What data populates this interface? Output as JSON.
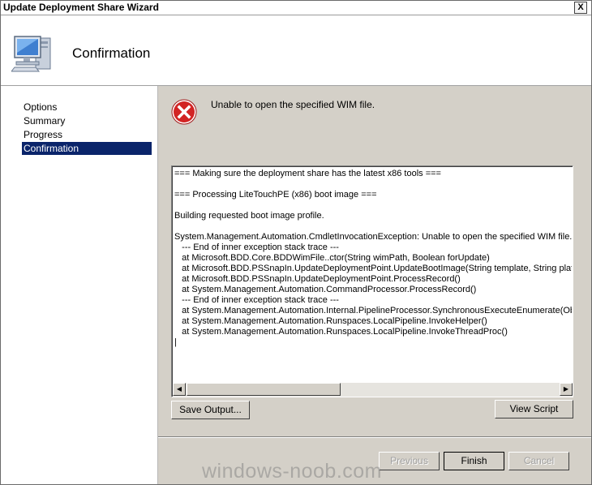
{
  "window": {
    "title": "Update Deployment Share Wizard",
    "close_label": "X"
  },
  "header": {
    "icon": "computer-monitor-icon",
    "title": "Confirmation"
  },
  "sidebar": {
    "items": [
      {
        "label": "Options",
        "active": false
      },
      {
        "label": "Summary",
        "active": false
      },
      {
        "label": "Progress",
        "active": false
      },
      {
        "label": "Confirmation",
        "active": true
      }
    ]
  },
  "content": {
    "error_icon": "error-x-icon",
    "error_message": "Unable to open the specified WIM file.",
    "log_lines": [
      "=== Making sure the deployment share has the latest x86 tools ===",
      "",
      "=== Processing LiteTouchPE (x86) boot image ===",
      "",
      "Building requested boot image profile.",
      "",
      "System.Management.Automation.CmdletInvocationException: Unable to open the specified WIM file. --->",
      "   --- End of inner exception stack trace ---",
      "   at Microsoft.BDD.Core.BDDWimFile..ctor(String wimPath, Boolean forUpdate)",
      "   at Microsoft.BDD.PSSnapIn.UpdateDeploymentPoint.UpdateBootImage(String template, String platform",
      "   at Microsoft.BDD.PSSnapIn.UpdateDeploymentPoint.ProcessRecord()",
      "   at System.Management.Automation.CommandProcessor.ProcessRecord()",
      "   --- End of inner exception stack trace ---",
      "   at System.Management.Automation.Internal.PipelineProcessor.SynchronousExecuteEnumerate(Object",
      "   at System.Management.Automation.Runspaces.LocalPipeline.InvokeHelper()",
      "   at System.Management.Automation.Runspaces.LocalPipeline.InvokeThreadProc()",
      "|"
    ],
    "save_output_label": "Save Output...",
    "view_script_label": "View Script"
  },
  "footer": {
    "previous_label": "Previous",
    "finish_label": "Finish",
    "cancel_label": "Cancel"
  },
  "watermark": "windows-noob.com"
}
